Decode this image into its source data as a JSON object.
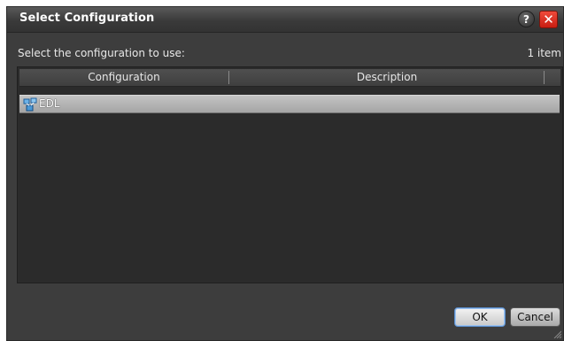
{
  "dialog": {
    "title": "Select Configuration",
    "help_label": "?",
    "close_label": "✕"
  },
  "prompt": {
    "text": "Select the configuration to use:",
    "count": "1 item"
  },
  "table": {
    "columns": [
      "Configuration",
      "Description"
    ],
    "rows": [
      {
        "name": "EDL",
        "description": "",
        "icon": "configuration-icon"
      }
    ]
  },
  "buttons": {
    "ok": "OK",
    "cancel": "Cancel"
  },
  "colors": {
    "dialog_bg": "#3d3d3d",
    "list_bg": "#2b2b2b",
    "selected_row": "#b5b5b5",
    "close_button": "#d9281a"
  }
}
